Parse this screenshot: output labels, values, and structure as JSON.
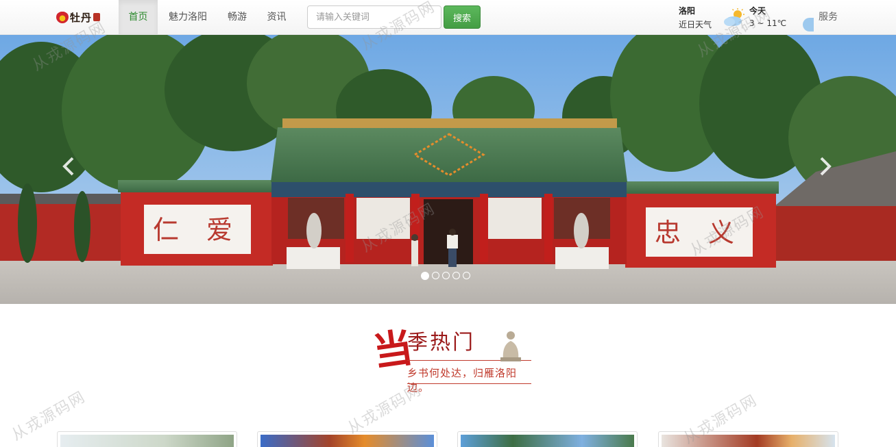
{
  "navbar": {
    "logo_text": "牡丹",
    "items": [
      {
        "label": "首页",
        "active": true
      },
      {
        "label": "魅力洛阳",
        "active": false
      },
      {
        "label": "畅游",
        "active": false
      },
      {
        "label": "资讯",
        "active": false
      }
    ],
    "search": {
      "placeholder": "请输入关键词",
      "button_label": "搜索"
    },
    "weather": {
      "city": "洛阳",
      "subtitle": "近日天气",
      "icon": "partly-cloudy-icon",
      "today_label": "今天",
      "today_temp": "3 ~ 11℃"
    },
    "service_label": "服务"
  },
  "carousel": {
    "slide_count": 5,
    "active_index": 0,
    "gate_sign_left": "仁 爱",
    "gate_sign_right": "忠 义"
  },
  "section": {
    "title_char": "当",
    "title_main": "季热门",
    "subtitle": "乡书何处达，归雁洛阳边。"
  },
  "cards": [
    {
      "name": "card-1"
    },
    {
      "name": "card-2"
    },
    {
      "name": "card-3"
    },
    {
      "name": "card-4"
    }
  ],
  "watermark": "从戎源码网",
  "colors": {
    "accent_green": "#5cb85c",
    "active_nav_text": "#2d8a2e",
    "title_red": "#c8191b"
  }
}
